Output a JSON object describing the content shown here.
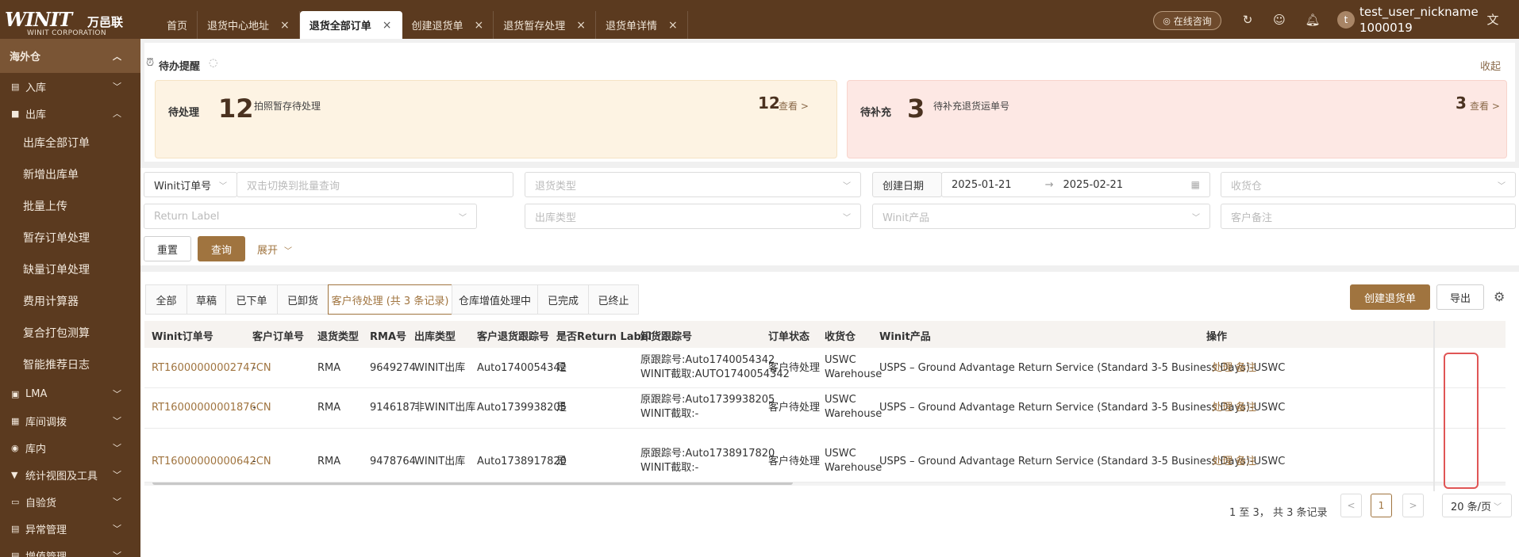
{
  "brand": {
    "word": "WINIT",
    "cn": "万邑联",
    "en": "WINIT CORPORATION"
  },
  "tabs": [
    {
      "label": "首页",
      "closable": false,
      "active": false
    },
    {
      "label": "退货中心地址",
      "closable": true,
      "active": false
    },
    {
      "label": "退货全部订单",
      "closable": true,
      "active": true
    },
    {
      "label": "创建退货单",
      "closable": true,
      "active": false
    },
    {
      "label": "退货暂存处理",
      "closable": true,
      "active": false
    },
    {
      "label": "退货单详情",
      "closable": true,
      "active": false
    }
  ],
  "header": {
    "consult": "在线咨询",
    "username": "test_user_nickname",
    "userid": "1000019",
    "avatar_letter": "t",
    "icons": [
      "refresh-icon",
      "smile-icon",
      "bell-icon",
      "translate-icon"
    ]
  },
  "sidebar": {
    "group": "海外仓",
    "items": [
      {
        "label": "入库",
        "icon": "file-icon"
      },
      {
        "label": "出库",
        "icon": "bag-icon"
      }
    ],
    "sub_items": [
      "出库全部订单",
      "新增出库单",
      "批量上传",
      "暂存订单处理",
      "缺量订单处理",
      "费用计算器",
      "复合打包测算",
      "智能推荐日志"
    ],
    "more_items": [
      {
        "label": "LMA",
        "icon": "box-icon"
      },
      {
        "label": "库间调拨",
        "icon": "grid-icon"
      },
      {
        "label": "库内",
        "icon": "circle-icon"
      },
      {
        "label": "统计视图及工具",
        "icon": "funnel-icon"
      },
      {
        "label": "自验货",
        "icon": "id-icon"
      },
      {
        "label": "异常管理",
        "icon": "doc-icon"
      },
      {
        "label": "增值管理",
        "icon": "doc-icon"
      }
    ]
  },
  "remind": {
    "title": "待办提醒",
    "collapse": "收起",
    "cards": [
      {
        "label": "待处理",
        "num": "12",
        "desc": "拍照暂存待处理",
        "right_num": "12",
        "view": "查看 >"
      },
      {
        "label": "待补充",
        "num": "3",
        "desc": "待补充退货运单号",
        "right_num": "3",
        "view": "查看 >"
      }
    ]
  },
  "filters": {
    "order_select": "Winit订单号",
    "order_placeholder": "双击切换到批量查询",
    "return_type": "退货类型",
    "date_label": "创建日期",
    "date_from": "2025-01-21",
    "date_to": "2025-02-21",
    "warehouse": "收货仓",
    "return_label": "Return Label",
    "outbound_type": "出库类型",
    "product": "Winit产品",
    "remark": "客户备注",
    "reset": "重置",
    "search": "查询",
    "expand": "展开"
  },
  "status_tabs": [
    "全部",
    "草稿",
    "已下单",
    "已卸货",
    "客户待处理 (共 3 条记录)",
    "仓库增值处理中",
    "已完成",
    "已终止"
  ],
  "actions": {
    "create": "创建退货单",
    "export": "导出"
  },
  "table": {
    "headers": [
      "Winit订单号",
      "客户订单号",
      "退货类型",
      "RMA号",
      "出库类型",
      "客户退货跟踪号",
      "是否Return Label",
      "卸货跟踪号",
      "订单状态",
      "收货仓",
      "Winit产品",
      "操作"
    ],
    "rows": [
      {
        "order": "RT16000000002747CN",
        "cust": "-",
        "rtype": "RMA",
        "rma": "9649274",
        "otype": "WINIT出库",
        "track": "Auto1740054342",
        "rl": "是",
        "unload1": "原跟踪号:Auto1740054342",
        "unload2": "WINIT截取:AUTO1740054342",
        "status": "客户待处理",
        "wh1": "USWC",
        "wh2": "Warehouse",
        "product": "USPS – Ground Advantage Return Service (Standard 3-5 Business Days)-USWC",
        "op1": "处理",
        "op2": "备注"
      },
      {
        "order": "RT16000000001876CN",
        "cust": "-",
        "rtype": "RMA",
        "rma": "9146187",
        "otype": "非WINIT出库",
        "track": "Auto1739938205",
        "rl": "是",
        "unload1": "原跟踪号:Auto1739938205",
        "unload2": "WINIT截取:-",
        "status": "客户待处理",
        "wh1": "USWC",
        "wh2": "Warehouse",
        "product": "USPS – Ground Advantage Return Service (Standard 3-5 Business Days)-USWC",
        "op1": "处理",
        "op2": "备注"
      },
      {
        "order": "RT16000000000642CN",
        "cust": "-",
        "rtype": "RMA",
        "rma": "9478764",
        "otype": "WINIT出库",
        "track": "Auto1738917820",
        "rl": "是",
        "unload1": "原跟踪号:Auto1738917820",
        "unload2": "WINIT截取:-",
        "status": "客户待处理",
        "wh1": "USWC",
        "wh2": "Warehouse",
        "product": "USPS – Ground Advantage Return Service (Standard 3-5 Business Days)-USWC",
        "op1": "处理",
        "op2": "备注"
      }
    ]
  },
  "pager": {
    "info": "1 至 3， 共 3 条记录",
    "page": "1",
    "size": "20 条/页"
  },
  "colors": {
    "brand": "#5b3a1f",
    "accent": "#a0743f",
    "highlight": "#e05555"
  }
}
